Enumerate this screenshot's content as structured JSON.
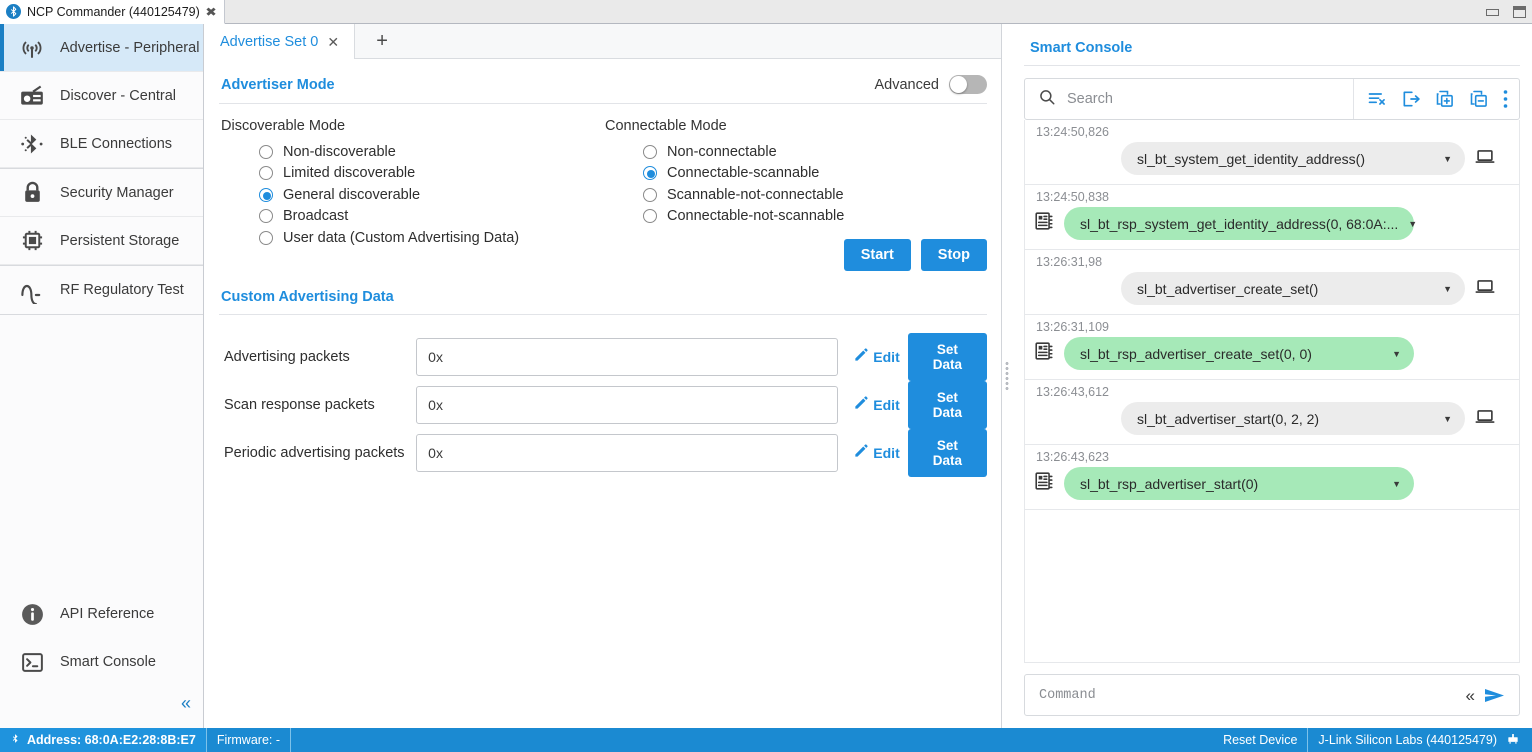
{
  "window": {
    "title": "NCP Commander (440125479)",
    "close_icon": "close-icon",
    "minimize_icon": "minimize-icon",
    "maximize_icon": "maximize-icon"
  },
  "sidebar": {
    "items": [
      {
        "label": "Advertise - Peripheral",
        "icon": "antenna-icon",
        "active": true
      },
      {
        "label": "Discover - Central",
        "icon": "radio-icon",
        "active": false
      },
      {
        "label": "BLE Connections",
        "icon": "bluetooth-icon",
        "active": false
      },
      {
        "label": "Security Manager",
        "icon": "lock-icon",
        "active": false
      },
      {
        "label": "Persistent Storage",
        "icon": "chip-icon",
        "active": false
      },
      {
        "label": "RF Regulatory Test",
        "icon": "waveform-icon",
        "active": false
      }
    ],
    "bottom_items": [
      {
        "label": "API Reference",
        "icon": "info-icon"
      },
      {
        "label": "Smart Console",
        "icon": "terminal-icon"
      }
    ],
    "collapse_icon": "chevron-double-left-icon"
  },
  "main": {
    "tabs": [
      {
        "label": "Advertise Set 0",
        "close_icon": "close-icon",
        "active": true
      }
    ],
    "add_tab_icon": "plus-icon",
    "advertiser_mode": {
      "title": "Advertiser Mode",
      "advanced_label": "Advanced",
      "advanced_on": false,
      "discoverable": {
        "title": "Discoverable Mode",
        "options": [
          {
            "label": "Non-discoverable",
            "selected": false
          },
          {
            "label": "Limited discoverable",
            "selected": false
          },
          {
            "label": "General discoverable",
            "selected": true
          },
          {
            "label": "Broadcast",
            "selected": false
          },
          {
            "label": "User data (Custom Advertising Data)",
            "selected": false
          }
        ]
      },
      "connectable": {
        "title": "Connectable Mode",
        "options": [
          {
            "label": "Non-connectable",
            "selected": false
          },
          {
            "label": "Connectable-scannable",
            "selected": true
          },
          {
            "label": "Scannable-not-connectable",
            "selected": false
          },
          {
            "label": "Connectable-not-scannable",
            "selected": false
          }
        ]
      },
      "start_label": "Start",
      "stop_label": "Stop"
    },
    "custom_advertising_data": {
      "title": "Custom Advertising Data",
      "edit_label": "Edit",
      "set_data_label": "Set Data",
      "rows": [
        {
          "label": "Advertising packets",
          "value": "0x"
        },
        {
          "label": "Scan response packets",
          "value": "0x"
        },
        {
          "label": "Periodic advertising packets",
          "value": "0x"
        }
      ]
    }
  },
  "console": {
    "title": "Smart Console",
    "search": {
      "placeholder": "Search",
      "value": "",
      "icon": "search-icon"
    },
    "tools": [
      {
        "name": "clear-list-icon"
      },
      {
        "name": "export-icon"
      },
      {
        "name": "expand-all-icon"
      },
      {
        "name": "collapse-all-icon"
      },
      {
        "name": "more-options-icon"
      }
    ],
    "log": [
      {
        "time": "13:24:50,826",
        "text": "sl_bt_system_get_identity_address()",
        "type": "command"
      },
      {
        "time": "13:24:50,838",
        "text": "sl_bt_rsp_system_get_identity_address(0, 68:0A:...",
        "type": "response"
      },
      {
        "time": "13:26:31,98",
        "text": "sl_bt_advertiser_create_set()",
        "type": "command"
      },
      {
        "time": "13:26:31,109",
        "text": "sl_bt_rsp_advertiser_create_set(0, 0)",
        "type": "response"
      },
      {
        "time": "13:26:43,612",
        "text": "sl_bt_advertiser_start(0, 2, 2)",
        "type": "command"
      },
      {
        "time": "13:26:43,623",
        "text": "sl_bt_rsp_advertiser_start(0)",
        "type": "response"
      }
    ],
    "command": {
      "placeholder": "Command",
      "value": "",
      "history_icon": "chevron-double-left-icon",
      "send_icon": "send-icon"
    }
  },
  "statusbar": {
    "address": "Address: 68:0A:E2:28:8B:E7",
    "firmware": "Firmware: -",
    "reset_device": "Reset Device",
    "jlink": "J-Link Silicon Labs (440125479)",
    "bluetooth_icon": "bluetooth-icon",
    "board_icon": "board-icon"
  },
  "colors": {
    "accent": "#1f8ddd",
    "status_bar": "#1b8ad2",
    "response_bubble": "#a6e9b8",
    "command_bubble": "#ececec",
    "sidebar_active": "#d6e9f8"
  }
}
